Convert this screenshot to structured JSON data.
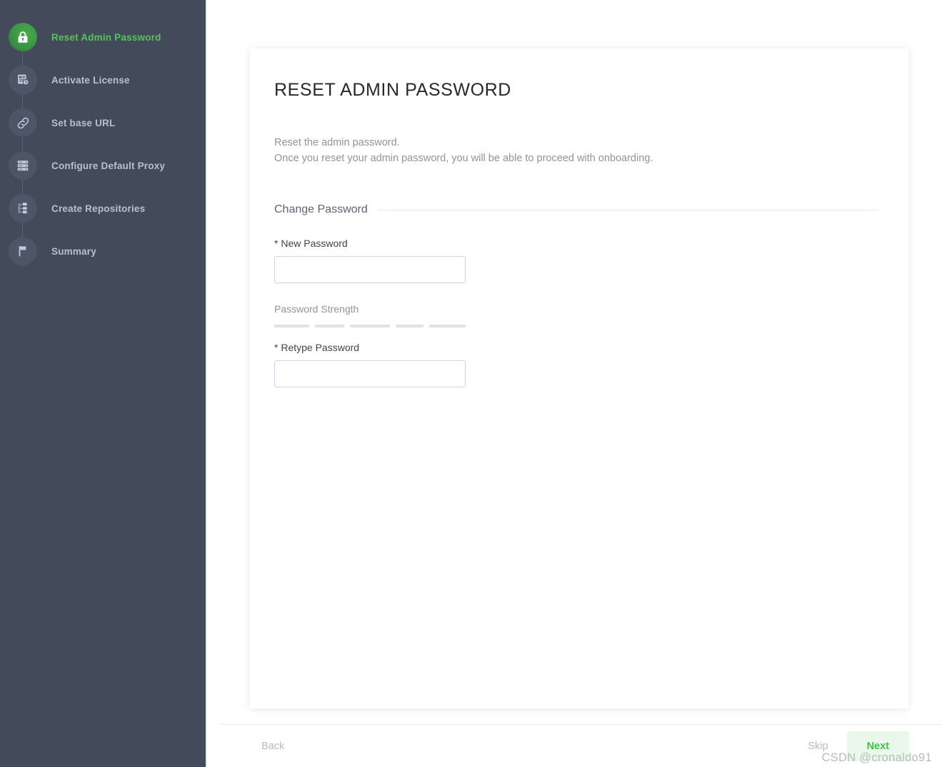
{
  "sidebar": {
    "steps": [
      {
        "label": "Reset Admin Password",
        "icon": "lock-icon",
        "state": "active"
      },
      {
        "label": "Activate License",
        "icon": "license-document-icon",
        "state": "pending"
      },
      {
        "label": "Set base URL",
        "icon": "link-chain-icon",
        "state": "pending"
      },
      {
        "label": "Configure Default Proxy",
        "icon": "server-stack-icon",
        "state": "pending"
      },
      {
        "label": "Create Repositories",
        "icon": "repository-tree-icon",
        "state": "pending"
      },
      {
        "label": "Summary",
        "icon": "flag-icon",
        "state": "pending"
      }
    ]
  },
  "main": {
    "title": "RESET ADMIN PASSWORD",
    "intro_line1": "Reset the admin password.",
    "intro_line2": "Once you reset your admin password, you will be able to proceed with onboarding.",
    "section_legend": "Change Password",
    "new_password": {
      "label": "* New Password",
      "value": "",
      "placeholder": ""
    },
    "password_strength": {
      "label": "Password Strength",
      "segments": 5,
      "filled": 0
    },
    "retype_password": {
      "label": "* Retype Password",
      "value": "",
      "placeholder": ""
    }
  },
  "footer": {
    "back_label": "Back",
    "skip_label": "Skip",
    "next_label": "Next"
  },
  "watermark": {
    "text": "CSDN @cronaldo91"
  },
  "colors": {
    "sidebar_bg": "#434a59",
    "active_green": "#56c45a",
    "next_text": "#3ec34b",
    "next_bg": "#eaf7eb",
    "icon_circle": "#4e5566",
    "muted_text": "#8d93a0"
  }
}
